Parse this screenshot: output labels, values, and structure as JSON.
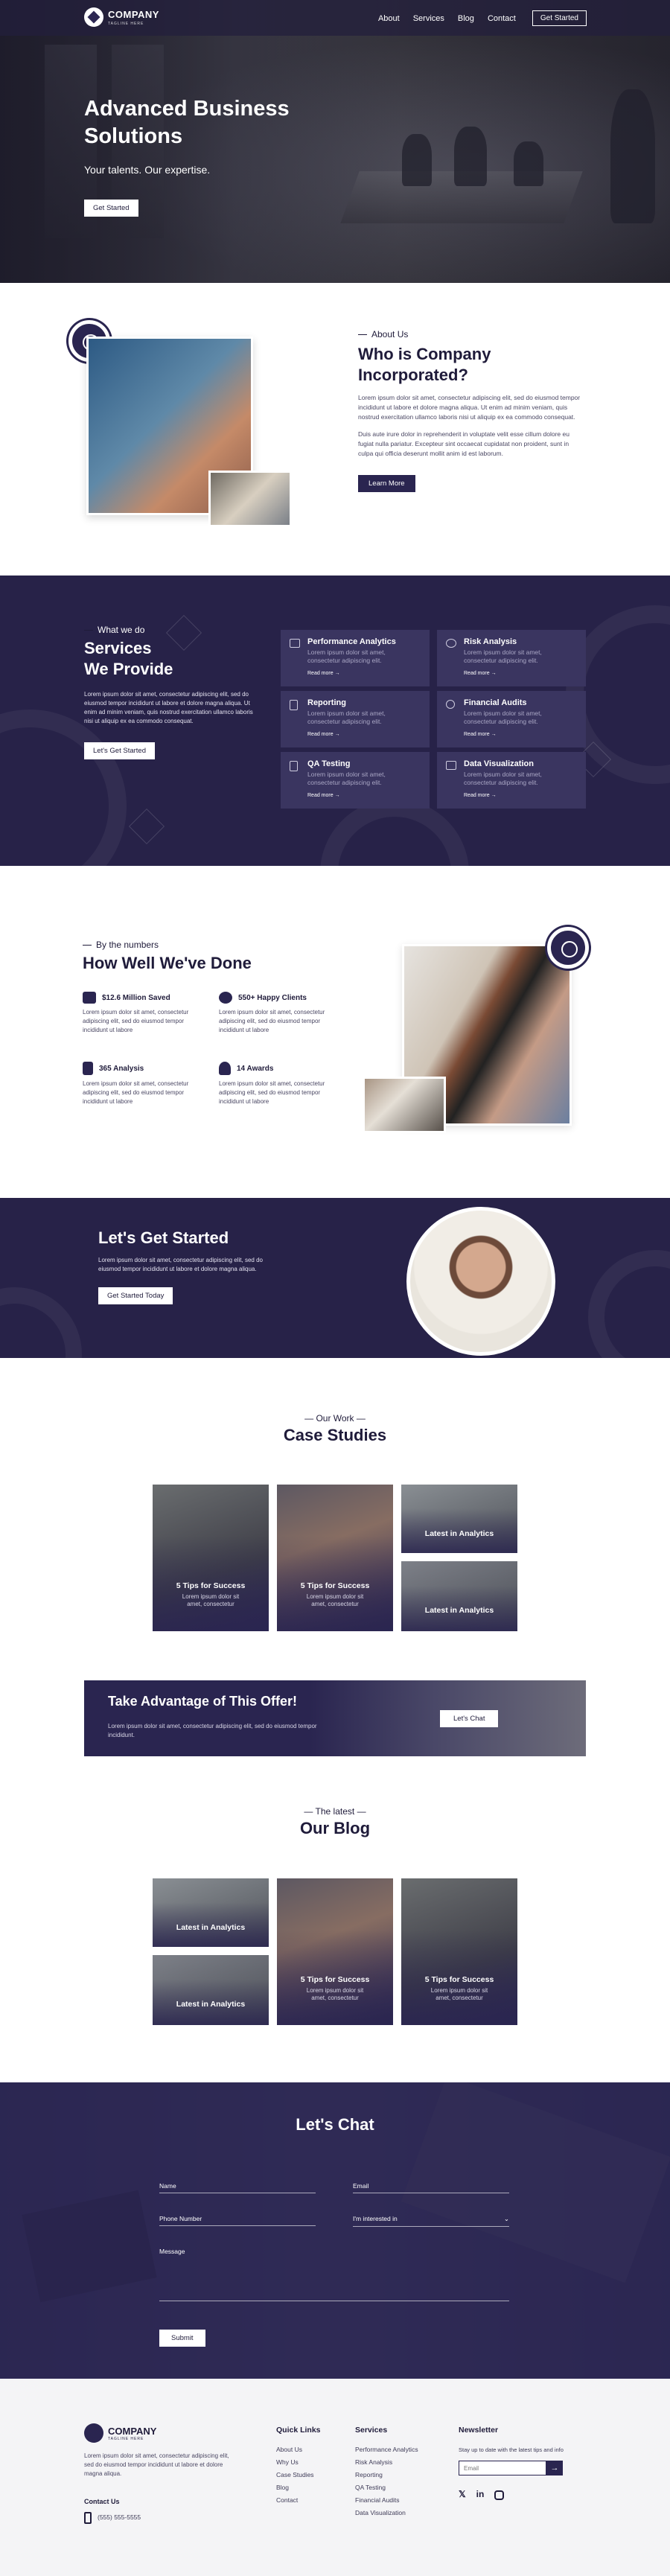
{
  "header": {
    "brand": "COMPANY",
    "tagline": "TAGLINE HERE",
    "nav": [
      "About",
      "Services",
      "Blog",
      "Contact"
    ],
    "cta": "Get Started"
  },
  "hero": {
    "title": "Advanced Business Solutions",
    "subtitle": "Your talents. Our expertise.",
    "button": "Get Started"
  },
  "about": {
    "eyebrow": "About Us",
    "title": "Who is Company Incorporated?",
    "p1": "Lorem ipsum dolor sit amet, consectetur adipiscing elit, sed do eiusmod tempor incididunt ut labore et dolore magna aliqua. Ut enim ad minim veniam, quis nostrud exercitation ullamco laboris nisi ut aliquip ex ea commodo consequat.",
    "p2": "Duis aute irure dolor in reprehenderit in voluptate velit esse cillum dolore eu fugiat nulla pariatur. Excepteur sint occaecat cupidatat non proident, sunt in culpa qui officia deserunt mollit anim id est laborum.",
    "button": "Learn More"
  },
  "services": {
    "eyebrow": "What we do",
    "title_line1": "Services",
    "title_line2": "We Provide",
    "text": "Lorem ipsum dolor sit amet, consectetur adipiscing elit, sed do eiusmod tempor incididunt ut labore et dolore magna aliqua. Ut enim ad minim veniam, quis nostrud exercitation ullamco laboris nisi ut aliquip ex ea commodo consequat.",
    "button": "Let's Get Started",
    "cards": [
      {
        "title": "Performance Analytics",
        "desc": "Lorem ipsum dolor sit amet, consectetur adipiscing elit.",
        "link": "Read more →",
        "icon": "chart-icon"
      },
      {
        "title": "Risk Analysis",
        "desc": "Lorem ipsum dolor sit amet, consectetur adipiscing elit.",
        "link": "Read more →",
        "icon": "compass-icon"
      },
      {
        "title": "Reporting",
        "desc": "Lorem ipsum dolor sit amet, consectetur adipiscing elit.",
        "link": "Read more →",
        "icon": "document-icon"
      },
      {
        "title": "Financial Audits",
        "desc": "Lorem ipsum dolor sit amet, consectetur adipiscing elit.",
        "link": "Read more →",
        "icon": "search-icon"
      },
      {
        "title": "QA Testing",
        "desc": "Lorem ipsum dolor sit amet, consectetur adipiscing elit.",
        "link": "Read more →",
        "icon": "clipboard-icon"
      },
      {
        "title": "Data Visualization",
        "desc": "Lorem ipsum dolor sit amet, consectetur adipiscing elit.",
        "link": "Read more →",
        "icon": "screen-icon"
      }
    ]
  },
  "numbers": {
    "eyebrow": "By the numbers",
    "title": "How Well We've Done",
    "stats": [
      {
        "title": "$12.6 Million Saved",
        "text": "Lorem ipsum dolor sit amet, consectetur adipiscing elit, sed do eiusmod tempor incididunt ut labore",
        "icon": "money-icon"
      },
      {
        "title": "550+ Happy Clients",
        "text": "Lorem ipsum dolor sit amet, consectetur adipiscing elit, sed do eiusmod tempor incididunt ut labore",
        "icon": "users-icon"
      },
      {
        "title": "365 Analysis",
        "text": "Lorem ipsum dolor sit amet, consectetur adipiscing elit, sed do eiusmod tempor incididunt ut labore",
        "icon": "clipboard-icon"
      },
      {
        "title": "14 Awards",
        "text": "Lorem ipsum dolor sit amet, consectetur adipiscing elit, sed do eiusmod tempor incididunt ut labore",
        "icon": "award-icon"
      }
    ]
  },
  "cta": {
    "title": "Let's Get Started",
    "text": "Lorem ipsum dolor sit amet, consectetur adipiscing elit, sed do eiusmod tempor incididunt ut labore et dolore magna aliqua.",
    "button": "Get Started Today"
  },
  "cases": {
    "eyebrow": "Our Work",
    "title": "Case Studies",
    "tiles": [
      {
        "title": "5 Tips for Success",
        "desc": "Lorem ipsum dolor sit amet, consectetur"
      },
      {
        "title": "5 Tips for Success",
        "desc": "Lorem ipsum dolor sit amet, consectetur"
      },
      {
        "title": "Latest in Analytics"
      },
      {
        "title": "Latest in Analytics"
      }
    ]
  },
  "offer": {
    "title": "Take Advantage of This Offer!",
    "text": "Lorem ipsum dolor sit amet, consectetur adipiscing elit, sed do eiusmod tempor incididunt.",
    "button": "Let's Chat"
  },
  "blog": {
    "eyebrow": "The latest",
    "title": "Our Blog",
    "tiles": [
      {
        "title": "Latest in Analytics"
      },
      {
        "title": "Latest in Analytics"
      },
      {
        "title": "5 Tips for Success",
        "desc": "Lorem ipsum dolor sit amet, consectetur"
      },
      {
        "title": "5 Tips for Success",
        "desc": "Lorem ipsum dolor sit amet, consectetur"
      }
    ]
  },
  "contact": {
    "title": "Let's Chat",
    "name": "Name",
    "email": "Email",
    "phone": "Phone Number",
    "interest": "I'm interested in",
    "message": "Message",
    "submit": "Submit"
  },
  "footer": {
    "brand": "COMPANY",
    "tagline": "TAGLINE HERE",
    "about": "Lorem ipsum dolor sit amet, consectetur adipiscing elit, sed do eiusmod tempor incididunt ut labore et dolore magna aliqua.",
    "contact_heading": "Contact Us",
    "phone": "(555) 555-5555",
    "quick_links_heading": "Quick Links",
    "quick_links": [
      "About Us",
      "Why Us",
      "Case Studies",
      "Blog",
      "Contact"
    ],
    "services_heading": "Services",
    "services": [
      "Performance Analytics",
      "Risk Analysis",
      "Reporting",
      "QA Testing",
      "Financial Audits",
      "Data Visualization"
    ],
    "newsletter_heading": "Newsletter",
    "newsletter_text": "Stay up to date with the latest tips and info",
    "email_placeholder": "Email"
  },
  "colors": {
    "primary": "#272248",
    "card": "#3a3560",
    "text": "#1f1b3a"
  }
}
